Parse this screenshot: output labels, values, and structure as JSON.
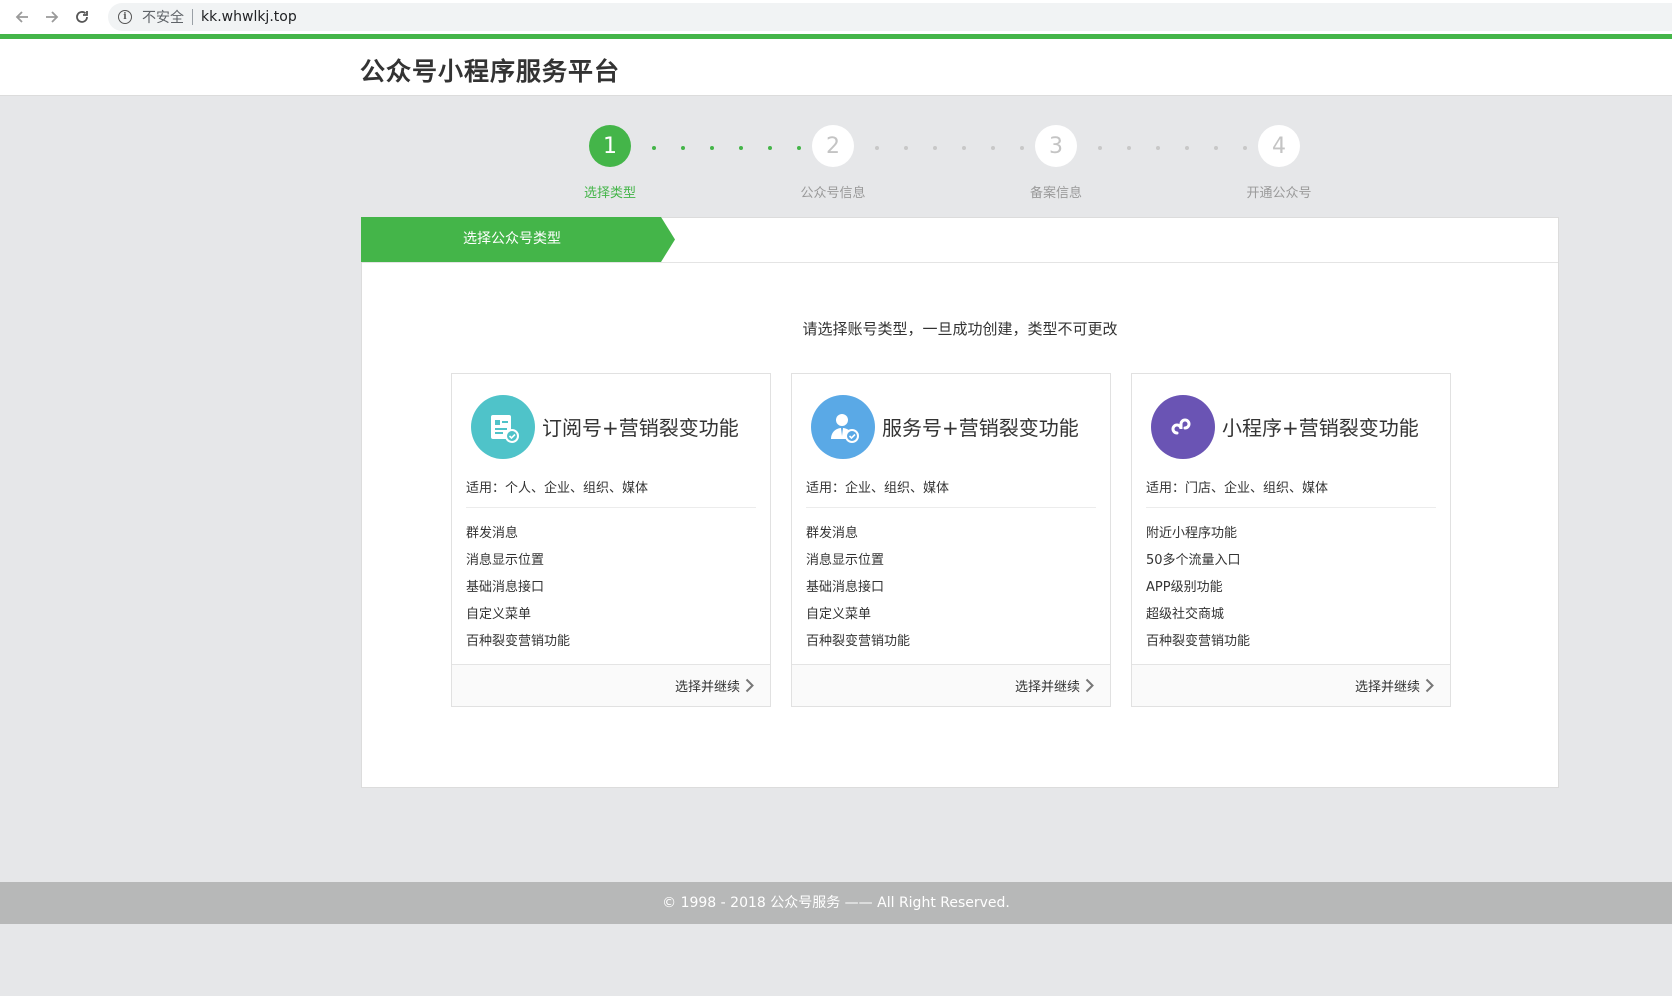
{
  "browser": {
    "insecure_label": "不安全",
    "url": "kk.whwlkj.top",
    "icons": [
      "back-arrow-icon",
      "forward-arrow-icon",
      "reload-icon",
      "info-icon"
    ]
  },
  "header": {
    "title": "公众号小程序服务平台"
  },
  "steps": [
    {
      "number": "1",
      "label": "选择类型",
      "active": true
    },
    {
      "number": "2",
      "label": "公众号信息",
      "active": false
    },
    {
      "number": "3",
      "label": "备案信息",
      "active": false
    },
    {
      "number": "4",
      "label": "开通公众号",
      "active": false
    }
  ],
  "panel": {
    "tab_label": "选择公众号类型",
    "tip": "请选择账号类型，一旦成功创建，类型不可更改"
  },
  "cards": [
    {
      "title": "订阅号+营销裂变功能",
      "apply": "适用：个人、企业、组织、媒体",
      "icon": "subscription-doc-icon",
      "icon_color": "#4fc3c9",
      "features": [
        "群发消息",
        "消息显示位置",
        "基础消息接口",
        "自定义菜单",
        "百种裂变营销功能"
      ],
      "button": "选择并继续"
    },
    {
      "title": "服务号+营销裂变功能",
      "apply": "适用：企业、组织、媒体",
      "icon": "service-person-icon",
      "icon_color": "#5aa9e6",
      "features": [
        "群发消息",
        "消息显示位置",
        "基础消息接口",
        "自定义菜单",
        "百种裂变营销功能"
      ],
      "button": "选择并继续"
    },
    {
      "title": "小程序+营销裂变功能",
      "apply": "适用：门店、企业、组织、媒体",
      "icon": "mini-program-icon",
      "icon_color": "#6a54b4",
      "features": [
        "附近小程序功能",
        "50多个流量入口",
        "APP级别功能",
        "超级社交商城",
        "百种裂变营销功能"
      ],
      "button": "选择并继续"
    }
  ],
  "footer": {
    "copyright": "© 1998 - 2018 公众号服务 —— All Right Reserved."
  },
  "colors": {
    "accent": "#44b549",
    "footer_bg": "#b7b8b8",
    "page_bg": "#e6e7e9"
  }
}
